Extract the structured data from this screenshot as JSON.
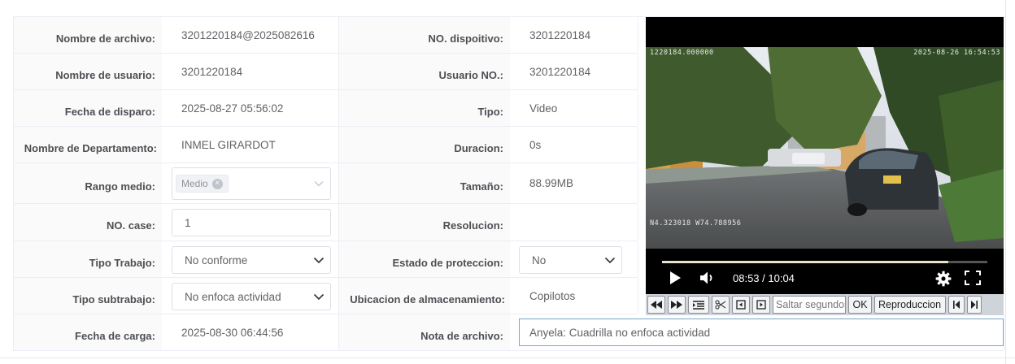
{
  "form": {
    "rows": [
      {
        "l1": "Nombre de archivo:",
        "v1": "3201220184@2025082616",
        "l2": "NO. dispoitivo:",
        "v2": "3201220184"
      },
      {
        "l1": "Nombre de usuario:",
        "v1": "3201220184",
        "l2": "Usuario NO.:",
        "v2": "3201220184"
      },
      {
        "l1": "Fecha de disparo:",
        "v1": "2025-08-27 05:56:02",
        "l2": "Tipo:",
        "v2": "Video"
      },
      {
        "l1": "Nombre de Departamento:",
        "v1": "INMEL GIRARDOT",
        "l2": "Duracion:",
        "v2": "0s"
      },
      {
        "l1": "Rango medio:",
        "v1": "",
        "l2": "Tamaño:",
        "v2": "88.99MB"
      },
      {
        "l1": "NO. case:",
        "v1": "",
        "l2": "Resolucion:",
        "v2": ""
      },
      {
        "l1": "Tipo Trabajo:",
        "v1": "",
        "l2": "Estado de proteccion:",
        "v2": ""
      },
      {
        "l1": "Tipo subtrabajo:",
        "v1": "",
        "l2": "Ubicacion de almacenamiento:",
        "v2": "Copilotos"
      },
      {
        "l1": "Fecha de carga:",
        "v1": "2025-08-30 06:44:56",
        "l2": "Nota de archivo:",
        "v2": ""
      }
    ],
    "rango_medio_tag": "Medio",
    "no_case_value": "1",
    "tipo_trabajo_value": "No conforme",
    "estado_proteccion_value": "No",
    "tipo_subtrabajo_value": "No enfoca actividad",
    "nota_archivo_value": "Anyela: Cuadrilla no enfoca actividad"
  },
  "video": {
    "osd_device": "1220184.000000",
    "osd_datetime": "2025-08-26 16:54:53",
    "osd_gps": "N4.323018  W74.788956",
    "time_display": "08:53 / 10:04",
    "progress": 0.88,
    "icons": [
      "play-icon",
      "volume-icon",
      "settings-icon",
      "fullscreen-icon"
    ]
  },
  "toolbar": {
    "seek_placeholder": "Saltar segundos",
    "ok_label": "OK",
    "playback_label": "Reproduccion",
    "icons": [
      "rewind-icon",
      "fast-forward-icon",
      "list-icon",
      "scissors-icon",
      "prev-frame-icon",
      "next-frame-icon",
      "skip-start-icon",
      "skip-end-icon"
    ]
  },
  "colors": {
    "label_bg": "#fafafa",
    "border": "#ebeef5",
    "video_bg": "#000000",
    "toolbar_bg": "#cfd3da"
  }
}
